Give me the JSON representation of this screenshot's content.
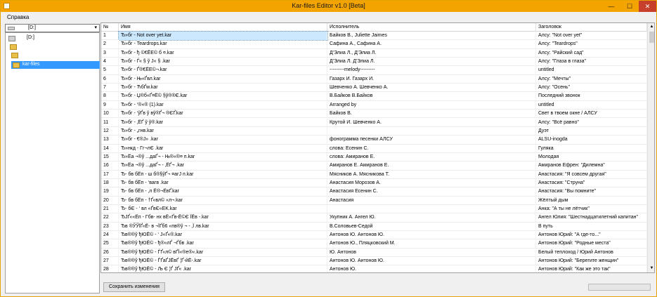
{
  "window": {
    "title": "Kar-files Editor v1.0 [Beta]",
    "min": "—",
    "max": "☐",
    "close": "✕"
  },
  "menu": {
    "help": "Справка"
  },
  "drive": {
    "selected": "[D:]",
    "chevron": "▾"
  },
  "tree": [
    {
      "label": "[D:]",
      "type": "drive"
    },
    {
      "label": "",
      "type": "folder"
    },
    {
      "label": "",
      "type": "folder"
    },
    {
      "label": "kar-files",
      "type": "folder",
      "selected": true
    }
  ],
  "table": {
    "headers": [
      "№",
      "Имя",
      "Исполнитель",
      "Заголовок"
    ],
    "rows": [
      [
        "1",
        "Ђ»бг - Not over yet.kar",
        "Байков В., Juliette Jaimes",
        "Алсу: \"Not over yet\""
      ],
      [
        "2",
        "Ђ»бг - Teardrops.kar",
        "Сафина А., Сафина А.",
        "Алсу: \"Teardrops\""
      ],
      [
        "3",
        "Ђ»бг - ђ ©€ЁЕ© б ¤.kar",
        "Д'Элиа Л., Д'Элиа Л.",
        "Алсу: \"Райский сад\""
      ],
      [
        "4",
        "Ђ»бг - Ѓ« § ў J« § .kar",
        "Д'Элиа Л.  Д'Элиа Л.",
        "Алсу: \"Глаза в глаза\""
      ],
      [
        "5",
        "Ђ»бг - Ґ®€ЁЕ©¬.kar",
        "---------melody---------",
        "untitled"
      ],
      [
        "6",
        "Ђ»бг - Њ«Ґвл.kar",
        "Газарх И.  Газарх И.",
        "Алсу: \"Мечты\""
      ],
      [
        "7",
        "Ђ»бг - ЋбҐ­м.kar",
        "Шевченко А.  Шевченко А.",
        "Алсу: \"Осень\""
      ],
      [
        "8",
        "Ђ»бг - Џ®б«Ґ¤­Ё© §ў®­®Є.kar",
        "В.Байков  В.Байков",
        "Последний звонок"
      ],
      [
        "9",
        "Ђ»бг - ‘®«® (1).kar",
        "Arranged by",
        "untitled"
      ],
      [
        "10",
        "Ђ»бг - ‘ўҐв ў вў®Ґ¬ ®Є­Ґ.kar",
        "Байков В.",
        "Свет в твоем окне / АЛСУ"
      ],
      [
        "11",
        "Ђ»бг - ‚ЁҐ ў ў­®.kar",
        "Крутой И.  Шевченко А.",
        "Алсу: \"Всё равно\""
      ],
      [
        "12",
        "Ђ»бг - „гнв.kar",
        "",
        "Дуэт"
      ],
      [
        "13",
        "Ђ»бг - €­®J» .kar",
        "фонограмма песенки АЛСУ",
        "ALSU-inogda"
      ],
      [
        "14",
        "Ђ»нкд  - Гг¬лЄ .kar",
        "слова: Есенин С.",
        "Гуляка"
      ],
      [
        "15",
        "Ђ»Ёа ¬®ў ...даҐ¬ - Њ®«®¤ п.kar",
        "слова: Амиранов Е.",
        "Молодая"
      ],
      [
        "16",
        "Ђ»Ёа ¬®ў ...даҐ¬ - ‚Ё­Ґ­¬ .kar",
        "Амиранов Е.  Амиранов Е.",
        "Амиранов Ефрен: \"Дилемна\""
      ],
      [
        "17",
        "Ђ- бв бЁп - ш б®§ўҐ¬ ¤агЈ п.kar",
        "Мясников А.  Мясникова Т.",
        "Анастасия: \"Я совсем другая\""
      ],
      [
        "18",
        "Ђ- бв бЁп - ‘вагв .kar",
        "Анастасия Морозов А.",
        "Анастасия: \"Струна\""
      ],
      [
        "19",
        "Ђ- бв бЁп - ‚л Ё®¬­ЁвҐ.kar",
        "Анастасия Есенин С.",
        "Анастасия: \"Вы помните\""
      ],
      [
        "20",
        "Ђ- бв бЁп - †Ґ«вл© «л¬.kar",
        "Анастасия",
        "Жёлтый дым"
      ],
      [
        "21",
        "Ђ- бЄ - ‘ вл «ҐвЄ«EK.kar",
        "",
        "Анка: \"А ты не лётчик\""
      ],
      [
        "22",
        "Ђ­JҐ««Ёп - Гбв- нх вЁ«Ґв-Ё©Є ЇЁв -.kar",
        "Укупник А.  Ангел Ю.",
        "Ангел Юлия: \"Шестнадцатилетний капитан\""
      ],
      [
        "23",
        "Ђ­в ®ЎЎЇҐ«Ё- в ¬ЇҐб6 «пв®ў ¬ - ‚Ї лв.kar",
        "В.Соловьев-Седой",
        "В путь"
      ],
      [
        "24",
        "Ђ­в®­®ў ђЮЁ© - ‘ J«Ґ«®.kar",
        "Антонов Ю.  Антонов Ю.",
        "Антонов Юрий: \"А где-то...\""
      ],
      [
        "25",
        "Ђ­в®­®ў ђЮЁ© - ђ®«­лҐ ¬Ґбв .kar",
        "Антонов Ю., Пляцковский М.",
        "Антонов Юрий: \"Родные места\""
      ],
      [
        "26",
        "Ђ­в®­®ў ђЮЁ© - ЃҐ«л© вҐЇ«®е®«.kar",
        "Ю. Антонов",
        "Белый теплоход / Юрий Антонов"
      ],
      [
        "27",
        "Ђ­в®­®ў ђЮЁ© - ЃҐаҐЈЁвҐ ¦Ґ-йЁ-.kar",
        "Антонов Ю.  Антонов Ю.",
        "Антонов Юрий: \"Берегите женщин\""
      ],
      [
        "28",
        "Ђ­в®­®ў ђЮЁ© - Љ Є ¦Ґ ЈҐ« .kar",
        "Антонов Ю.",
        "Антонов Юрий: \"Как же это так\""
      ]
    ]
  },
  "scroll": {
    "up": "▲",
    "down": "▼"
  },
  "footer": {
    "save_label": "Сохранить изменения",
    "progress_fraction": 0.0
  }
}
